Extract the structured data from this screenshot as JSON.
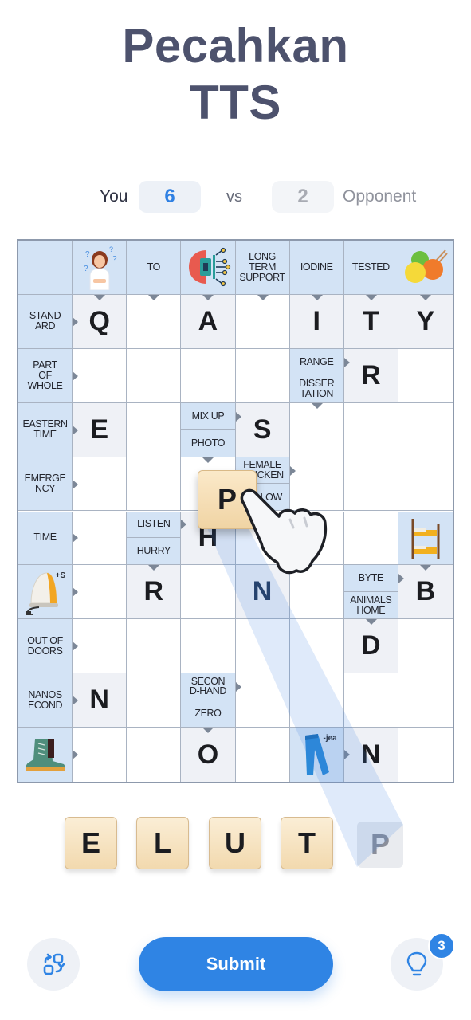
{
  "header": {
    "title_line1": "Pecahkan",
    "title_line2": "TTS"
  },
  "score": {
    "you_label": "You",
    "you_score": "6",
    "vs_label": "vs",
    "opponent_score": "2",
    "opponent_label": "Opponent"
  },
  "colors": {
    "accent": "#2f84e4",
    "clue_bg": "#d3e3f5",
    "filled_bg": "#eff1f6",
    "title": "#4d526d",
    "tile": "#f2d9ae"
  },
  "grid": {
    "cols": 8,
    "rows": 10,
    "cells": [
      [
        {
          "type": "clue",
          "text": ""
        },
        {
          "type": "image",
          "icon": "confused-woman-icon",
          "arrow": "down"
        },
        {
          "type": "clue",
          "text": "TO",
          "arrow": "down"
        },
        {
          "type": "image",
          "icon": "ai-brain-icon",
          "arrow": "down"
        },
        {
          "type": "clue",
          "text": "LONG\nTERM\nSUPPORT",
          "arrow": "down"
        },
        {
          "type": "clue",
          "text": "IODINE",
          "arrow": "down"
        },
        {
          "type": "clue",
          "text": "TESTED",
          "arrow": "down"
        },
        {
          "type": "image",
          "icon": "yarn-balls-icon",
          "arrow": "down"
        }
      ],
      [
        {
          "type": "clue",
          "text": "STAND\nARD",
          "arrow": "right"
        },
        {
          "type": "letter",
          "value": "Q"
        },
        {
          "type": "empty"
        },
        {
          "type": "letter",
          "value": "A"
        },
        {
          "type": "empty"
        },
        {
          "type": "letter",
          "value": "I"
        },
        {
          "type": "letter",
          "value": "T"
        },
        {
          "type": "letter",
          "value": "Y"
        }
      ],
      [
        {
          "type": "clue",
          "text": "PART\nOF\nWHOLE",
          "arrow": "right"
        },
        {
          "type": "empty"
        },
        {
          "type": "empty"
        },
        {
          "type": "empty"
        },
        {
          "type": "empty"
        },
        {
          "type": "split",
          "top": "RANGE",
          "top_arrow": "right",
          "bottom": "DISSER\nTATION",
          "bottom_arrow": "down"
        },
        {
          "type": "letter",
          "value": "R"
        },
        {
          "type": "empty"
        }
      ],
      [
        {
          "type": "clue",
          "text": "EASTERN\nTIME",
          "arrow": "right"
        },
        {
          "type": "letter",
          "value": "E"
        },
        {
          "type": "empty"
        },
        {
          "type": "split",
          "top": "MIX UP",
          "top_arrow": "right",
          "bottom": "PHOTO",
          "bottom_arrow": "down"
        },
        {
          "type": "letter",
          "value": "S"
        },
        {
          "type": "empty"
        },
        {
          "type": "empty"
        },
        {
          "type": "empty"
        }
      ],
      [
        {
          "type": "clue",
          "text": "EMERGE\nNCY",
          "arrow": "right"
        },
        {
          "type": "empty"
        },
        {
          "type": "empty"
        },
        {
          "type": "empty"
        },
        {
          "type": "split",
          "top": "FEMALE\nCHICKEN",
          "top_arrow": "right",
          "bottom": "YELLOW",
          "bottom_arrow": "down"
        },
        {
          "type": "empty"
        },
        {
          "type": "empty"
        },
        {
          "type": "empty"
        }
      ],
      [
        {
          "type": "clue",
          "text": "TIME",
          "arrow": "right"
        },
        {
          "type": "empty"
        },
        {
          "type": "split",
          "top": "LISTEN",
          "top_arrow": "right",
          "bottom": "HURRY",
          "bottom_arrow": "down"
        },
        {
          "type": "letter",
          "value": "H"
        },
        {
          "type": "empty"
        },
        {
          "type": "empty"
        },
        {
          "type": "empty"
        },
        {
          "type": "image",
          "icon": "bunk-bed-icon",
          "arrow": "down"
        }
      ],
      [
        {
          "type": "image",
          "icon": "clothes-iron-icon",
          "suffix": "+S",
          "arrow": "right"
        },
        {
          "type": "empty"
        },
        {
          "type": "letter",
          "value": "R"
        },
        {
          "type": "empty"
        },
        {
          "type": "letter",
          "value": "N",
          "highlight": true
        },
        {
          "type": "empty"
        },
        {
          "type": "split",
          "top": "BYTE",
          "top_arrow": "right",
          "bottom": "ANIMALS\nHOME",
          "bottom_arrow": "down"
        },
        {
          "type": "letter",
          "value": "B"
        }
      ],
      [
        {
          "type": "clue",
          "text": "OUT OF\nDOORS",
          "arrow": "right"
        },
        {
          "type": "empty"
        },
        {
          "type": "empty"
        },
        {
          "type": "empty"
        },
        {
          "type": "empty"
        },
        {
          "type": "empty"
        },
        {
          "type": "letter",
          "value": "D"
        },
        {
          "type": "empty"
        }
      ],
      [
        {
          "type": "clue",
          "text": "NANOS\nECOND",
          "arrow": "right"
        },
        {
          "type": "letter",
          "value": "N"
        },
        {
          "type": "empty"
        },
        {
          "type": "split",
          "top": "SECON\nD-HAND",
          "top_arrow": "right",
          "bottom": "ZERO",
          "bottom_arrow": "down"
        },
        {
          "type": "empty"
        },
        {
          "type": "empty"
        },
        {
          "type": "empty"
        },
        {
          "type": "empty"
        }
      ],
      [
        {
          "type": "image",
          "icon": "boot-icon",
          "arrow": "right"
        },
        {
          "type": "empty"
        },
        {
          "type": "empty"
        },
        {
          "type": "letter",
          "value": "O"
        },
        {
          "type": "empty"
        },
        {
          "type": "image",
          "icon": "jeans-icon",
          "suffix": "-jea",
          "arrow": "right"
        },
        {
          "type": "letter",
          "value": "N"
        },
        {
          "type": "empty"
        }
      ]
    ]
  },
  "dragging_tile": {
    "letter": "P"
  },
  "rack": {
    "tiles": [
      "E",
      "L",
      "U",
      "T"
    ],
    "placeholder_tile": "P"
  },
  "footer": {
    "shuffle_icon": "shuffle-icon",
    "submit_label": "Submit",
    "hint_icon": "lightbulb-icon",
    "hint_count": "3"
  }
}
